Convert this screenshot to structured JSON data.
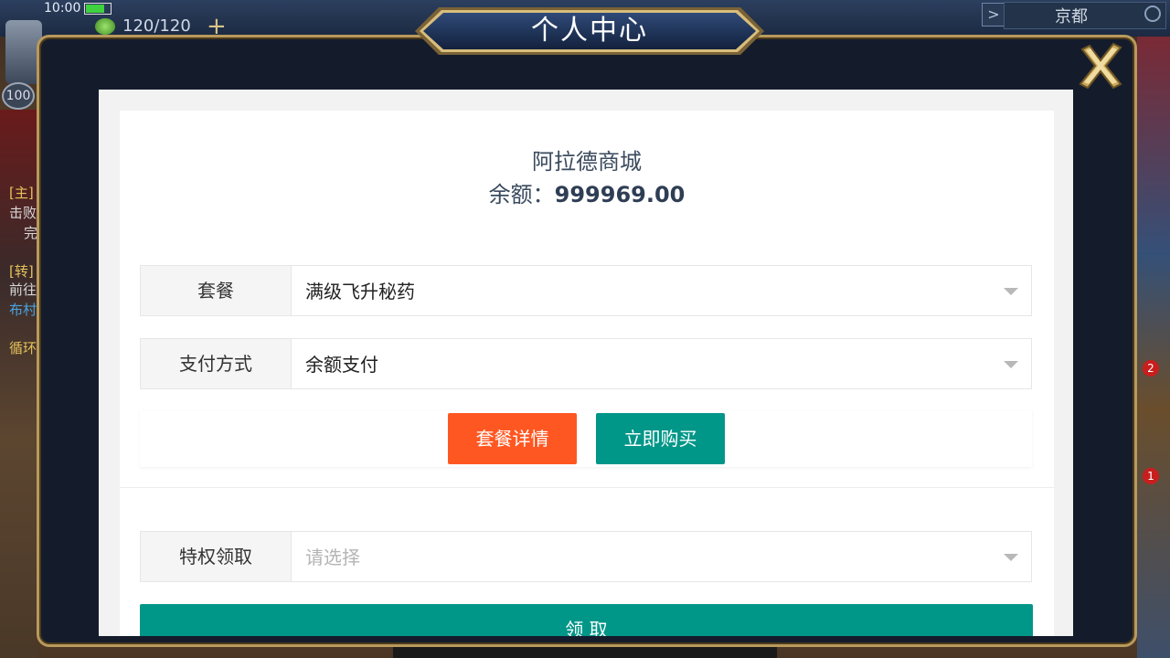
{
  "status_bar": {
    "time": "10:00",
    "stamina": "120/120",
    "plus": "+",
    "level": "100",
    "city": "京都",
    "arrow": ">"
  },
  "side_quests": [
    {
      "tag": "[主]",
      "line1": "击败",
      "line2": "完"
    },
    {
      "tag": "[转]",
      "line1": "前往",
      "line2": "布村"
    },
    {
      "tag": "循环",
      "line1": "",
      "line2": ""
    }
  ],
  "side_badges": [
    "2",
    "1"
  ],
  "modal": {
    "title": "个人中心",
    "close_icon": "close-x-icon",
    "shop_name": "阿拉德商城",
    "balance_label": "余额：",
    "balance_value": "999969.00",
    "fields": {
      "package": {
        "label": "套餐",
        "value": "满级飞升秘药"
      },
      "payment": {
        "label": "支付方式",
        "value": "余额支付"
      },
      "privilege": {
        "label": "特权领取",
        "placeholder": "请选择"
      }
    },
    "buttons": {
      "detail": "套餐详情",
      "buy": "立即购买",
      "claim": "领 取"
    },
    "colors": {
      "detail_button": "#ff5722",
      "buy_button": "#009688",
      "claim_button": "#009688",
      "frame_gold": "#b89a5c",
      "modal_bg": "#141c2c"
    }
  }
}
